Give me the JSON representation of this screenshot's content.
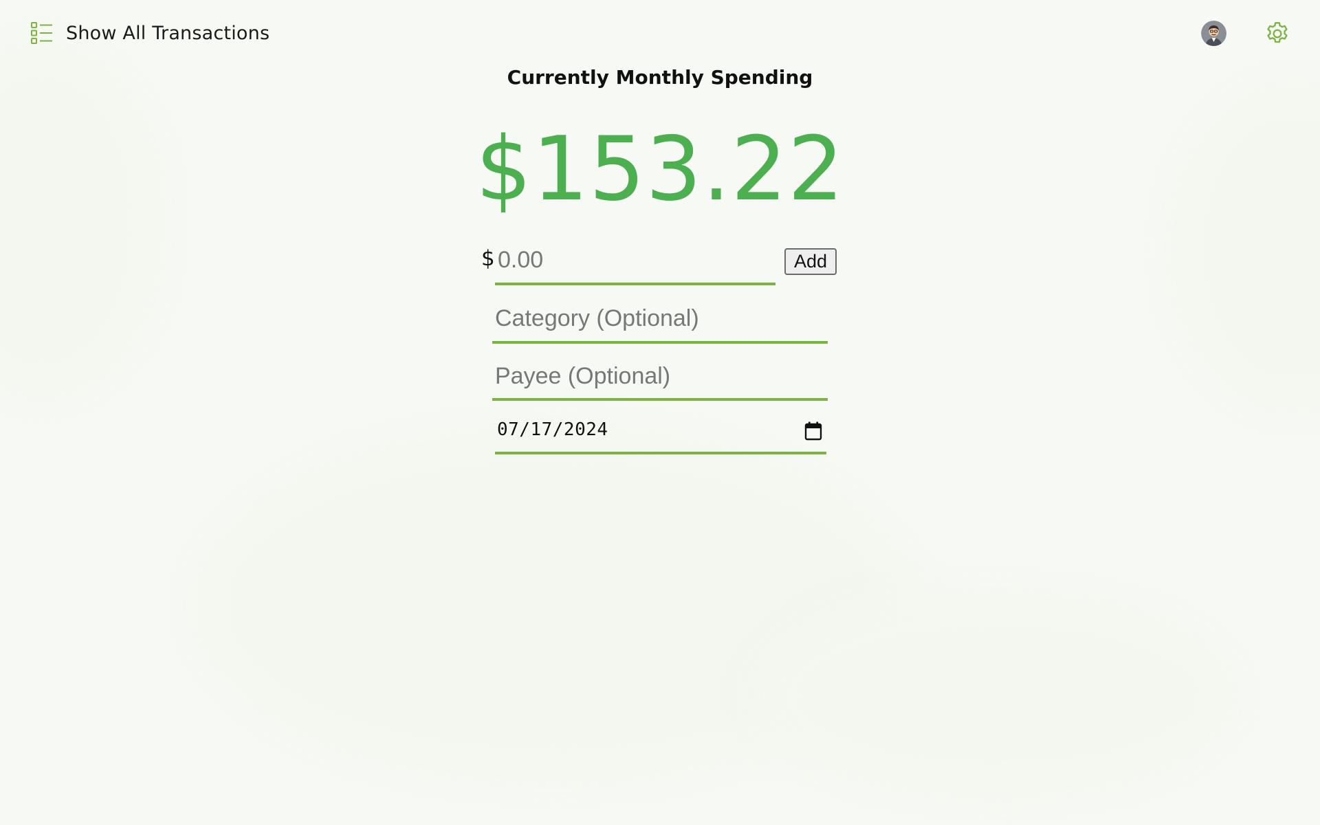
{
  "header": {
    "show_all_label": "Show All Transactions",
    "list_icon": "list-icon",
    "avatar_icon": "user-avatar",
    "settings_icon": "gear-icon"
  },
  "summary": {
    "title": "Currently Monthly Spending",
    "amount": "$153.22",
    "amount_color": "#4caf50"
  },
  "form": {
    "currency_symbol": "$",
    "amount_placeholder": "0.00",
    "amount_value": "",
    "add_label": "Add",
    "category_placeholder": "Category (Optional)",
    "category_value": "",
    "payee_placeholder": "Payee (Optional)",
    "payee_value": "",
    "date_value": "07/17/2024",
    "calendar_icon": "calendar-icon"
  },
  "colors": {
    "accent": "#7cb342",
    "background": "#f7faf4"
  }
}
